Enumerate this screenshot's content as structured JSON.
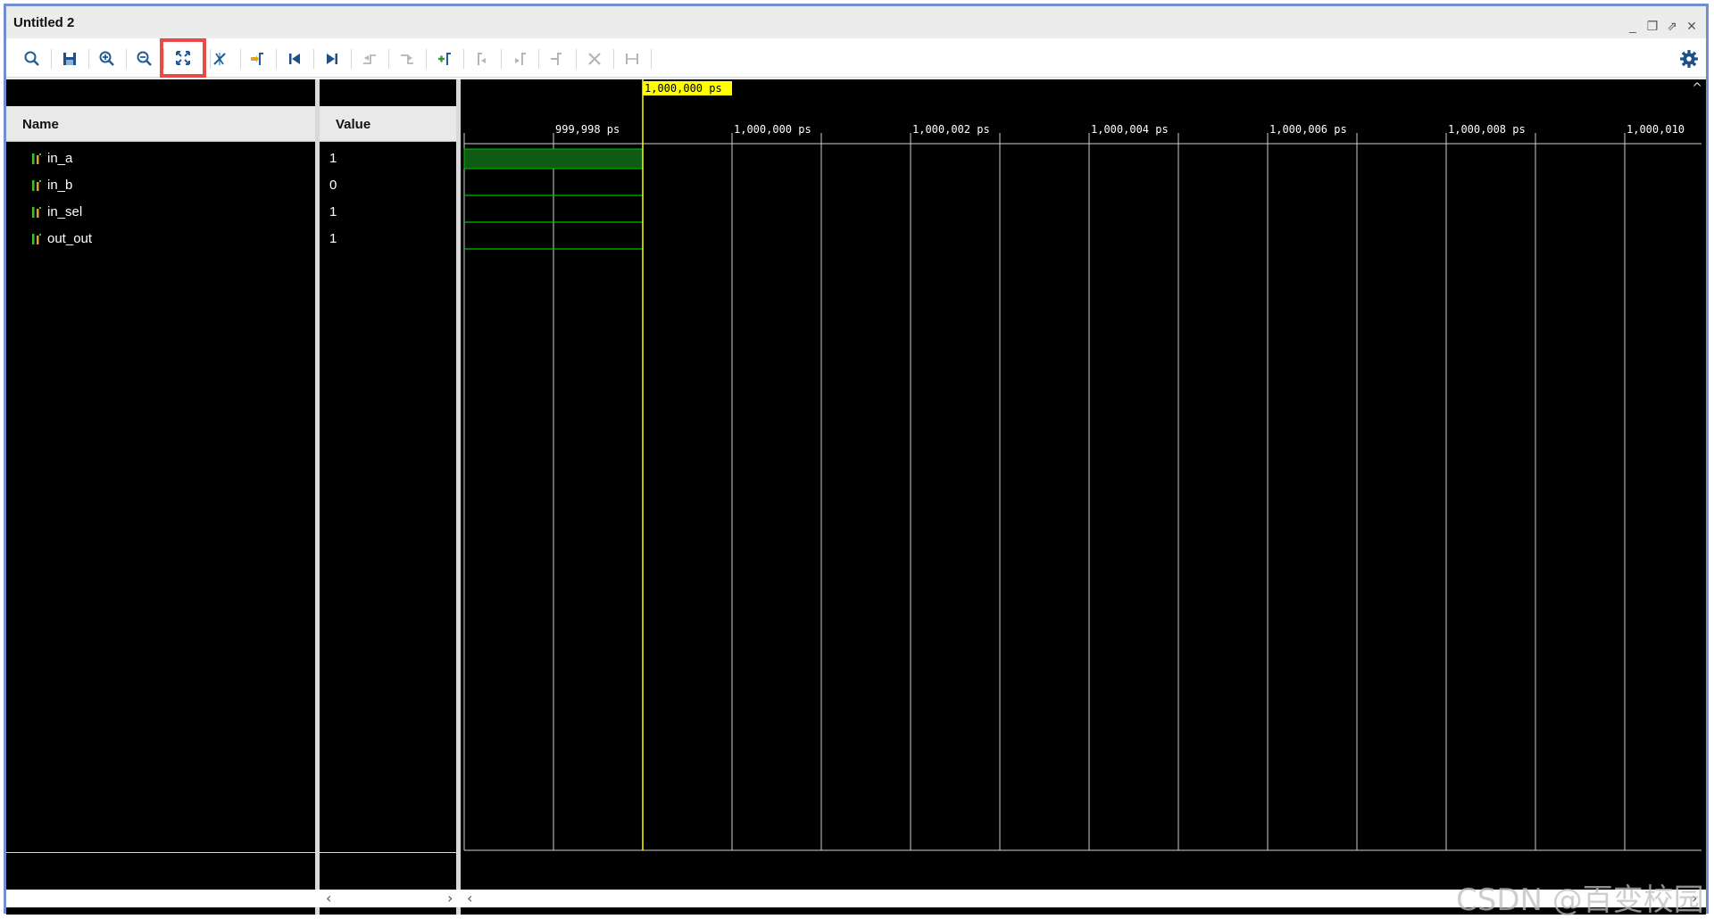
{
  "window": {
    "title": "Untitled 2",
    "controls": [
      "minimize-icon",
      "restore-icon",
      "maximize-icon",
      "close-icon"
    ]
  },
  "toolbar": {
    "buttons": [
      {
        "name": "search-icon",
        "enabled": true
      },
      {
        "name": "save-icon",
        "enabled": true
      },
      {
        "name": "zoom-in-icon",
        "enabled": true
      },
      {
        "name": "zoom-out-icon",
        "enabled": true
      },
      {
        "name": "zoom-fit-icon",
        "enabled": true,
        "highlighted": true
      },
      {
        "name": "cursor-snap-icon",
        "enabled": true
      },
      {
        "name": "go-to-cursor-icon",
        "enabled": true
      },
      {
        "name": "go-to-start-icon",
        "enabled": true
      },
      {
        "name": "go-to-end-icon",
        "enabled": true
      },
      {
        "name": "previous-transition-icon",
        "enabled": false
      },
      {
        "name": "next-transition-icon",
        "enabled": false
      },
      {
        "name": "add-marker-icon",
        "enabled": true
      },
      {
        "name": "previous-marker-icon",
        "enabled": false
      },
      {
        "name": "next-marker-icon",
        "enabled": false
      },
      {
        "name": "swap-cursors-icon",
        "enabled": false
      },
      {
        "name": "delete-marker-icon",
        "enabled": false
      },
      {
        "name": "measure-icon",
        "enabled": false
      }
    ],
    "settings_icon": "gear-icon"
  },
  "name_panel": {
    "header": "Name"
  },
  "value_panel": {
    "header": "Value"
  },
  "signals": [
    {
      "name": "in_a",
      "value": "1"
    },
    {
      "name": "in_b",
      "value": "0"
    },
    {
      "name": "in_sel",
      "value": "1"
    },
    {
      "name": "out_out",
      "value": "1"
    }
  ],
  "timeline": {
    "cursor_label": "1,000,000 ps",
    "tick_labels": [
      "999,998 ps",
      "1,000,000 ps",
      "1,000,002 ps",
      "1,000,004 ps",
      "1,000,006 ps",
      "1,000,008 ps",
      "1,000,010"
    ],
    "cursor_color": "#ffff00",
    "wave_color": "#00c000",
    "grid_color": "#d0d0d0"
  },
  "watermark": "CSDN @百变校园"
}
